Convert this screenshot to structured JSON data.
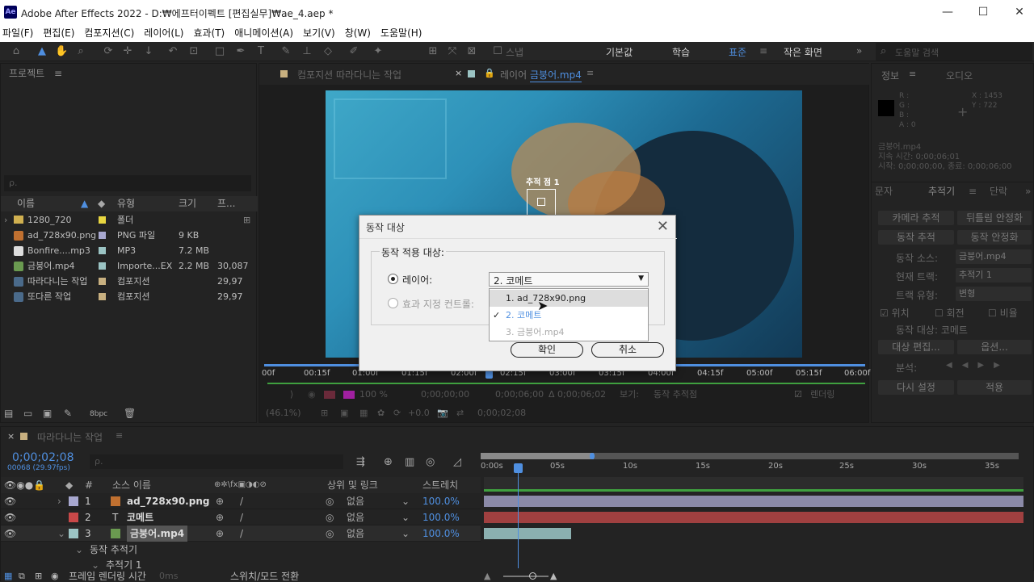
{
  "titlebar": {
    "title": "Adobe After Effects 2022 - D:₩에프터이펙트 [편집실무]₩ae_4.aep *",
    "logo": "Ae",
    "minimize": "—",
    "maximize": "☐",
    "close": "✕"
  },
  "menu": [
    "파일(F)",
    "편집(E)",
    "컴포지션(C)",
    "레이어(L)",
    "효과(T)",
    "애니메이션(A)",
    "보기(V)",
    "창(W)",
    "도움말(H)"
  ],
  "toolbar": {
    "snap_label": "스냅",
    "workspaces": [
      "기본값",
      "학습",
      "표준",
      "작은 화면"
    ],
    "active_workspace": "표준",
    "search_placeholder": "도움말 검색",
    "more": "»"
  },
  "project": {
    "title": "프로젝트",
    "search_placeholder": "ρ.",
    "columns": [
      "이름",
      "유형",
      "크기",
      "프..."
    ],
    "items": [
      {
        "name": "1280_720",
        "type": "폴더",
        "size": "",
        "fps": "",
        "color": "#e8d640",
        "icon": "folder-icon",
        "expand": "›"
      },
      {
        "name": "ad_728x90.png",
        "type": "PNG 파일",
        "size": "9 KB",
        "fps": "",
        "color": "#a8a8d0",
        "icon": "image-icon"
      },
      {
        "name": "Bonfire....mp3",
        "type": "MP3",
        "size": "7.2 MB",
        "fps": "",
        "color": "#9bc4c4",
        "icon": "audio-icon"
      },
      {
        "name": "금붕어.mp4",
        "type": "Importe...EX",
        "size": "2.2 MB",
        "fps": "30,087",
        "color": "#9bc4c4",
        "icon": "video-icon"
      },
      {
        "name": "따라다니는 작업",
        "type": "컴포지션",
        "size": "",
        "fps": "29,97",
        "color": "#c8b080",
        "icon": "composition-icon"
      },
      {
        "name": "또다른 작업",
        "type": "컴포지션",
        "size": "",
        "fps": "29,97",
        "color": "#c8b080",
        "icon": "composition-icon"
      }
    ],
    "bpc": "8bpc"
  },
  "viewer": {
    "comp_tab": "컴포지션 따라다니는 작업",
    "layer_tab_prefix": "레이어",
    "layer_tab_name": "금붕어.mp4",
    "tracker_label": "추적 점 1",
    "ruler": [
      "00f",
      "00:15f",
      "01:00f",
      "01:15f",
      "02:00f",
      "02:15f",
      "03:00f",
      "03:15f",
      "04:00f",
      "04:15f",
      "05:00f",
      "05:15f",
      "06:00f"
    ],
    "current_time": "0;00;00;00",
    "duration": "0;00;06;00",
    "delta": "Δ 0;00;06;02",
    "view_label": "보기:",
    "view_value": "동작 추적점",
    "render_label": "렌더링",
    "zoom": "(46.1%)",
    "zoom_pct": "100 %",
    "exposure": "+0.0",
    "time_readout": "0;00;02;08"
  },
  "dialog": {
    "title": "동작 대상",
    "group_label": "동작 적용 대상:",
    "layer_option": "레이어:",
    "effect_option": "효과 지정 컨트롤:",
    "selected_value": "2. 코메트",
    "options": [
      {
        "label": "1. ad_728x90.png",
        "state": "hover",
        "check": ""
      },
      {
        "label": "2. 코메트",
        "state": "selected",
        "check": "✓"
      },
      {
        "label": "3. 금붕어.mp4",
        "state": "disabled",
        "check": ""
      }
    ],
    "ok": "확인",
    "cancel": "취소",
    "close": "✕"
  },
  "info": {
    "tab": "정보",
    "tab2": "오디오",
    "rgb": [
      "R :",
      "G :",
      "B :",
      "A : 0"
    ],
    "x": "X : 1453",
    "y": "Y : 722",
    "source": "금붕어.mp4",
    "duration": "지속 시간: 0;00;06;01",
    "start_end": "시작: 0;00;00;00, 종료: 0;00;06;00"
  },
  "tracker": {
    "tabs": [
      "문자",
      "추적기",
      "단락"
    ],
    "btn_camera": "카메라 추적",
    "btn_warp": "뒤틀림 안정화",
    "btn_track": "동작 추적",
    "btn_stabilize": "동작 안정화",
    "source_label": "동작 소스:",
    "source_value": "금붕어.mp4",
    "current_label": "현재 트랙:",
    "current_value": "추적기 1",
    "type_label": "트랙 유형:",
    "type_value": "변형",
    "chk_position": "위치",
    "chk_rotation": "회전",
    "chk_scale": "비율",
    "target_label": "동작 대상: 코메트",
    "edit_target": "대상 편집...",
    "options": "옵션...",
    "analyze": "분석:",
    "reset": "다시 설정",
    "apply": "적용"
  },
  "timeline": {
    "comp_name": "따라다니는 작업",
    "timecode": "0;00;02;08",
    "frames": "00068 (29.97fps)",
    "search_placeholder": "ρ.",
    "columns": {
      "num": "#",
      "source": "소스 이름",
      "parent": "상위 및 링크",
      "stretch": "스트레치"
    },
    "layers": [
      {
        "num": "1",
        "name": "ad_728x90.png",
        "parent": "없음",
        "stretch": "100.0%",
        "color": "#a8a8d0",
        "track_color": "#8b8aa8"
      },
      {
        "num": "2",
        "name": "코메트",
        "parent": "없음",
        "stretch": "100.0%",
        "color": "#c84848",
        "track_color": "#a04040"
      },
      {
        "num": "3",
        "name": "금붕어.mp4",
        "parent": "없음",
        "stretch": "100.0%",
        "color": "#9bc4c4",
        "track_color": "#8bb0b0"
      }
    ],
    "sub1": "동작 추적기",
    "sub2": "추적기 1",
    "ruler": [
      "0:00s",
      "05s",
      "10s",
      "15s",
      "20s",
      "25s",
      "30s",
      "35s"
    ],
    "bottom_render": "프레임 렌더링 시간",
    "bottom_render_val": "0ms",
    "bottom_toggle": "스위치/모드 전환"
  }
}
